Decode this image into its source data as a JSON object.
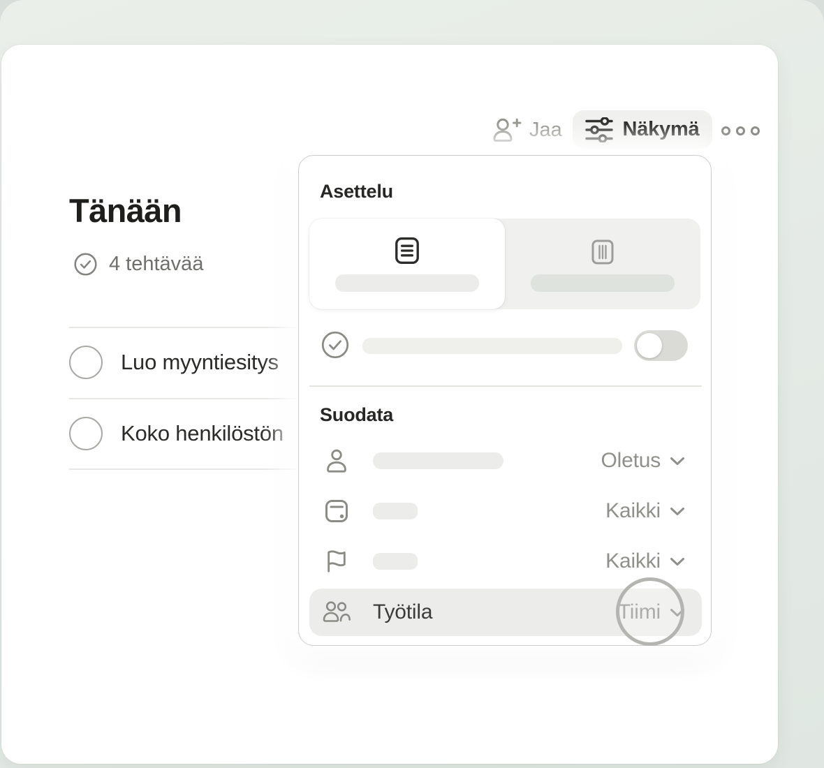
{
  "toolbar": {
    "share_label": "Jaa",
    "view_label": "Näkymä"
  },
  "page": {
    "title": "Tänään",
    "task_count": "4 tehtävää"
  },
  "tasks": [
    {
      "title": "Luo myyntiesitys"
    },
    {
      "title": "Koko henkilöstön"
    }
  ],
  "popover": {
    "layout_section_title": "Asettelu",
    "filter_section_title": "Suodata",
    "layout_options": [
      {
        "name": "list-layout",
        "selected": true
      },
      {
        "name": "board-layout",
        "selected": false
      }
    ],
    "show_completed_toggle_state": "off",
    "filters": [
      {
        "icon": "person-icon",
        "value": "Oletus"
      },
      {
        "icon": "project-icon",
        "value": "Kaikki"
      },
      {
        "icon": "flag-icon",
        "value": "Kaikki"
      },
      {
        "icon": "people-icon",
        "label": "Työtila",
        "value": "Tiimi",
        "highlighted": true
      }
    ]
  },
  "colors": {
    "frame": "#e4eae5",
    "card": "#ffffff",
    "button-bg": "#f0f0ee",
    "text-dark": "#1e1e1c",
    "text-gray": "#90908b",
    "skeleton": "#ececea",
    "skeleton-dark": "#dee3de",
    "highlight-row": "#ececea",
    "ring": "#b4b4b0"
  }
}
